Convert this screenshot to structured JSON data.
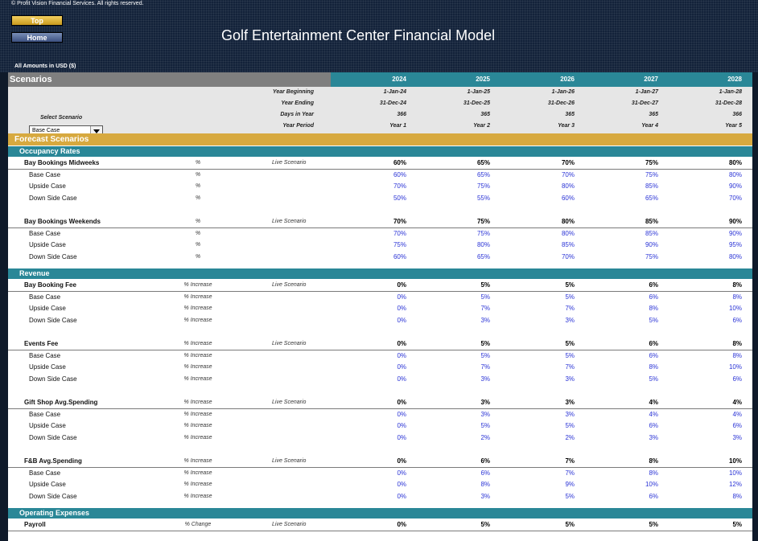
{
  "header": {
    "copyright": "© Profit Vision Financial Services. All rights reserved.",
    "top_button": "Top",
    "home_button": "Home",
    "title": "Golf Entertainment Center Financial Model",
    "amounts": "All Amounts in  USD ($)"
  },
  "scenarios_label": "Scenarios",
  "years": [
    "2024",
    "2025",
    "2026",
    "2027",
    "2028"
  ],
  "info": {
    "year_beginning_label": "Year Beginning",
    "year_ending_label": "Year Ending",
    "days_label": "Days in Year",
    "period_label": "Year Period",
    "select_label": "Select Scenario",
    "selected": "Base Case",
    "year_beginning": [
      "1-Jan-24",
      "1-Jan-25",
      "1-Jan-26",
      "1-Jan-27",
      "1-Jan-28"
    ],
    "year_ending": [
      "31-Dec-24",
      "31-Dec-25",
      "31-Dec-26",
      "31-Dec-27",
      "31-Dec-28"
    ],
    "days": [
      "366",
      "365",
      "365",
      "365",
      "366"
    ],
    "period": [
      "Year 1",
      "Year 2",
      "Year 3",
      "Year 4",
      "Year 5"
    ]
  },
  "forecast_label": "Forecast Scenarios",
  "sections": [
    {
      "title": "Occupancy Rates",
      "groups": [
        {
          "name": "Bay Bookings Midweeks",
          "unit": "%",
          "live": "Live Scenario",
          "main": [
            "60%",
            "65%",
            "70%",
            "75%",
            "80%"
          ],
          "cases": [
            {
              "name": "Base Case",
              "unit": "%",
              "values": [
                "60%",
                "65%",
                "70%",
                "75%",
                "80%"
              ]
            },
            {
              "name": "Upside Case",
              "unit": "%",
              "values": [
                "70%",
                "75%",
                "80%",
                "85%",
                "90%"
              ]
            },
            {
              "name": "Down Side Case",
              "unit": "%",
              "values": [
                "50%",
                "55%",
                "60%",
                "65%",
                "70%"
              ]
            }
          ]
        },
        {
          "name": "Bay Bookings Weekends",
          "unit": "%",
          "live": "Live Scenario",
          "main": [
            "70%",
            "75%",
            "80%",
            "85%",
            "90%"
          ],
          "cases": [
            {
              "name": "Base Case",
              "unit": "%",
              "values": [
                "70%",
                "75%",
                "80%",
                "85%",
                "90%"
              ]
            },
            {
              "name": "Upside Case",
              "unit": "%",
              "values": [
                "75%",
                "80%",
                "85%",
                "90%",
                "95%"
              ]
            },
            {
              "name": "Down Side Case",
              "unit": "%",
              "values": [
                "60%",
                "65%",
                "70%",
                "75%",
                "80%"
              ]
            }
          ]
        }
      ]
    },
    {
      "title": "Revenue",
      "groups": [
        {
          "name": "Bay Booking Fee",
          "unit": "% Increase",
          "live": "Live Scenario",
          "main": [
            "0%",
            "5%",
            "5%",
            "6%",
            "8%"
          ],
          "cases": [
            {
              "name": "Base Case",
              "unit": "% Increase",
              "values": [
                "0%",
                "5%",
                "5%",
                "6%",
                "8%"
              ]
            },
            {
              "name": "Upside Case",
              "unit": "% Increase",
              "values": [
                "0%",
                "7%",
                "7%",
                "8%",
                "10%"
              ]
            },
            {
              "name": "Down Side Case",
              "unit": "% Increase",
              "values": [
                "0%",
                "3%",
                "3%",
                "5%",
                "6%"
              ]
            }
          ]
        },
        {
          "name": "Events Fee",
          "unit": "% Increase",
          "live": "Live Scenario",
          "main": [
            "0%",
            "5%",
            "5%",
            "6%",
            "8%"
          ],
          "cases": [
            {
              "name": "Base Case",
              "unit": "% Increase",
              "values": [
                "0%",
                "5%",
                "5%",
                "6%",
                "8%"
              ]
            },
            {
              "name": "Upside Case",
              "unit": "% Increase",
              "values": [
                "0%",
                "7%",
                "7%",
                "8%",
                "10%"
              ]
            },
            {
              "name": "Down Side Case",
              "unit": "% Increase",
              "values": [
                "0%",
                "3%",
                "3%",
                "5%",
                "6%"
              ]
            }
          ]
        },
        {
          "name": "Gift Shop Avg.Spending",
          "unit": "% Increase",
          "live": "Live Scenario",
          "main": [
            "0%",
            "3%",
            "3%",
            "4%",
            "4%"
          ],
          "cases": [
            {
              "name": "Base Case",
              "unit": "% Increase",
              "values": [
                "0%",
                "3%",
                "3%",
                "4%",
                "4%"
              ]
            },
            {
              "name": "Upside Case",
              "unit": "% Increase",
              "values": [
                "0%",
                "5%",
                "5%",
                "6%",
                "6%"
              ]
            },
            {
              "name": "Down Side Case",
              "unit": "% Increase",
              "values": [
                "0%",
                "2%",
                "2%",
                "3%",
                "3%"
              ]
            }
          ]
        },
        {
          "name": "F&B Avg.Spending",
          "unit": "% Increase",
          "live": "Live Scenario",
          "main": [
            "0%",
            "6%",
            "7%",
            "8%",
            "10%"
          ],
          "cases": [
            {
              "name": "Base Case",
              "unit": "% Increase",
              "values": [
                "0%",
                "6%",
                "7%",
                "8%",
                "10%"
              ]
            },
            {
              "name": "Upside Case",
              "unit": "% Increase",
              "values": [
                "0%",
                "8%",
                "9%",
                "10%",
                "12%"
              ]
            },
            {
              "name": "Down Side Case",
              "unit": "% Increase",
              "values": [
                "0%",
                "3%",
                "5%",
                "6%",
                "8%"
              ]
            }
          ]
        }
      ]
    },
    {
      "title": "Operating Expenses",
      "groups": [
        {
          "name": "Payroll",
          "unit": "% Change",
          "live": "Live Scenario",
          "main": [
            "0%",
            "5%",
            "5%",
            "5%",
            "5%"
          ],
          "cases": []
        }
      ]
    }
  ]
}
